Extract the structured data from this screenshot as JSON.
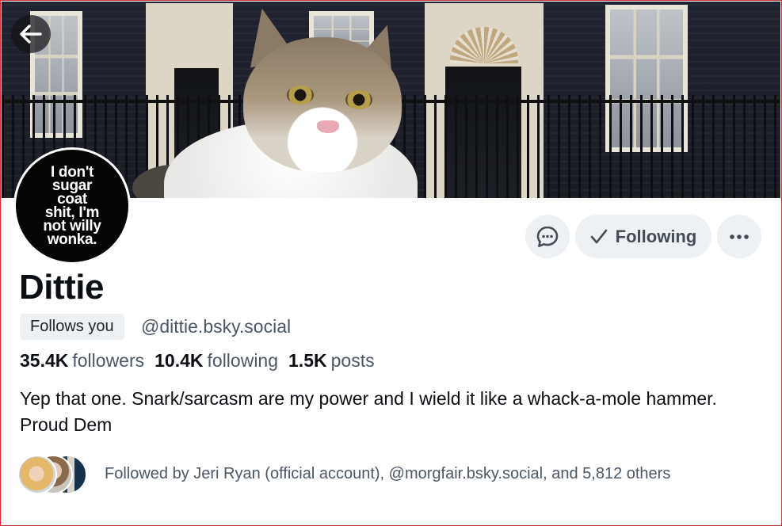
{
  "profile": {
    "avatar_text": "I don't\nsugar\ncoat\nshit, I'm\nnot willy\nwonka.",
    "display_name": "Dittie",
    "follows_you_badge": "Follows you",
    "handle": "@dittie.bsky.social",
    "stats": {
      "followers_count": "35.4K",
      "followers_label": "followers",
      "following_count": "10.4K",
      "following_label": "following",
      "posts_count": "1.5K",
      "posts_label": "posts"
    },
    "bio": "Yep that one. Snark/sarcasm are my power and I wield it like a whack-a-mole hammer. Proud Dem",
    "known_followers_text": "Followed by Jeri Ryan (official account), @morgfair.bsky.social, and 5,812 others"
  },
  "actions": {
    "following_label": "Following",
    "message_icon": "chat-bubble-icon",
    "more_icon": "ellipsis-icon",
    "back_icon": "arrow-left-icon"
  },
  "colors": {
    "button_bg": "#eef1f4",
    "muted_text": "#4b5764",
    "primary_text": "#0b0f14"
  }
}
